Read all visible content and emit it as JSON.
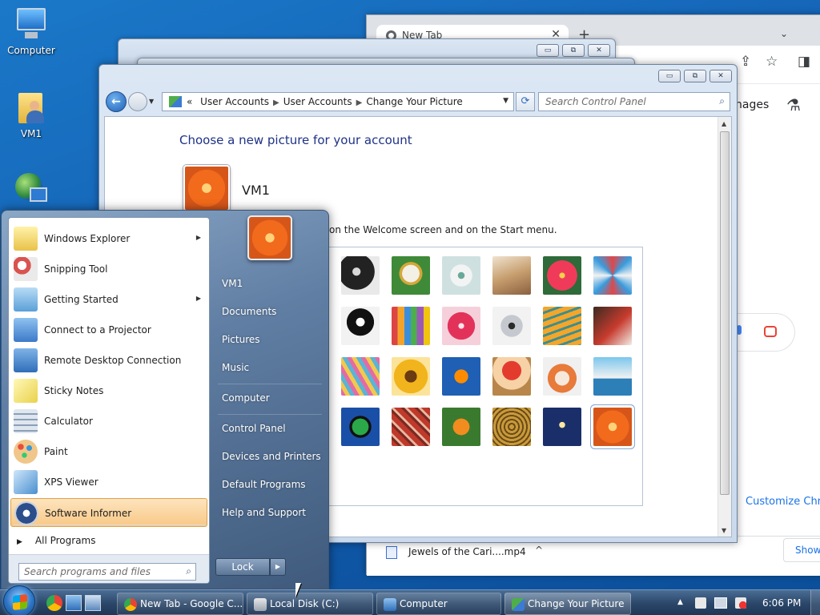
{
  "desktop": {
    "icons": [
      {
        "label": "Computer"
      },
      {
        "label": "VM1"
      }
    ]
  },
  "chrome": {
    "tab_title": "New Tab",
    "tab_close": "✕",
    "new_tab": "+",
    "tab_menu": "⌄",
    "images_link": "nages",
    "customize": "Customize Chrom",
    "download_name": "Jewels of the Cari....mp4",
    "download_chev": "^",
    "show_all": "Show"
  },
  "control_panel": {
    "breadcrumb": [
      "User Accounts",
      "User Accounts",
      "Change Your Picture"
    ],
    "breadcrumb_lead": "«",
    "search_placeholder": "Search Control Panel",
    "heading": "Choose a new picture for your account",
    "username": "VM1",
    "description": "on the Welcome screen and on the Start menu.",
    "caption_buttons": [
      "▭",
      "⧉",
      "✕"
    ]
  },
  "start_menu": {
    "programs": [
      {
        "label": "Windows Explorer",
        "submenu": true,
        "color": "#e9c24a"
      },
      {
        "label": "Snipping Tool",
        "submenu": false,
        "color": "#d9534f"
      },
      {
        "label": "Getting Started",
        "submenu": true,
        "color": "#5aa0d8"
      },
      {
        "label": "Connect to a Projector",
        "submenu": false,
        "color": "#3c79c9"
      },
      {
        "label": "Remote Desktop Connection",
        "submenu": false,
        "color": "#2f6eb8"
      },
      {
        "label": "Sticky Notes",
        "submenu": false,
        "color": "#f3e47a"
      },
      {
        "label": "Calculator",
        "submenu": false,
        "color": "#8aa0b8"
      },
      {
        "label": "Paint",
        "submenu": false,
        "color": "#e8a03c"
      },
      {
        "label": "XPS Viewer",
        "submenu": false,
        "color": "#4a90d0"
      },
      {
        "label": "Software Informer",
        "submenu": false,
        "color": "#2c4e8a"
      }
    ],
    "all_programs": "All Programs",
    "search_placeholder": "Search programs and files",
    "right_items": [
      "VM1",
      "Documents",
      "Pictures",
      "Music",
      "Computer",
      "Control Panel",
      "Devices and Printers",
      "Default Programs",
      "Help and Support"
    ],
    "lock_label": "Lock",
    "lock_arrow": "▶"
  },
  "taskbar": {
    "buttons": [
      {
        "label": "New Tab - Google C..."
      },
      {
        "label": "Local Disk (C:)"
      },
      {
        "label": "Computer"
      },
      {
        "label": "Change Your Picture"
      }
    ],
    "clock": "6:06 PM",
    "tray_arrow": "▲"
  }
}
